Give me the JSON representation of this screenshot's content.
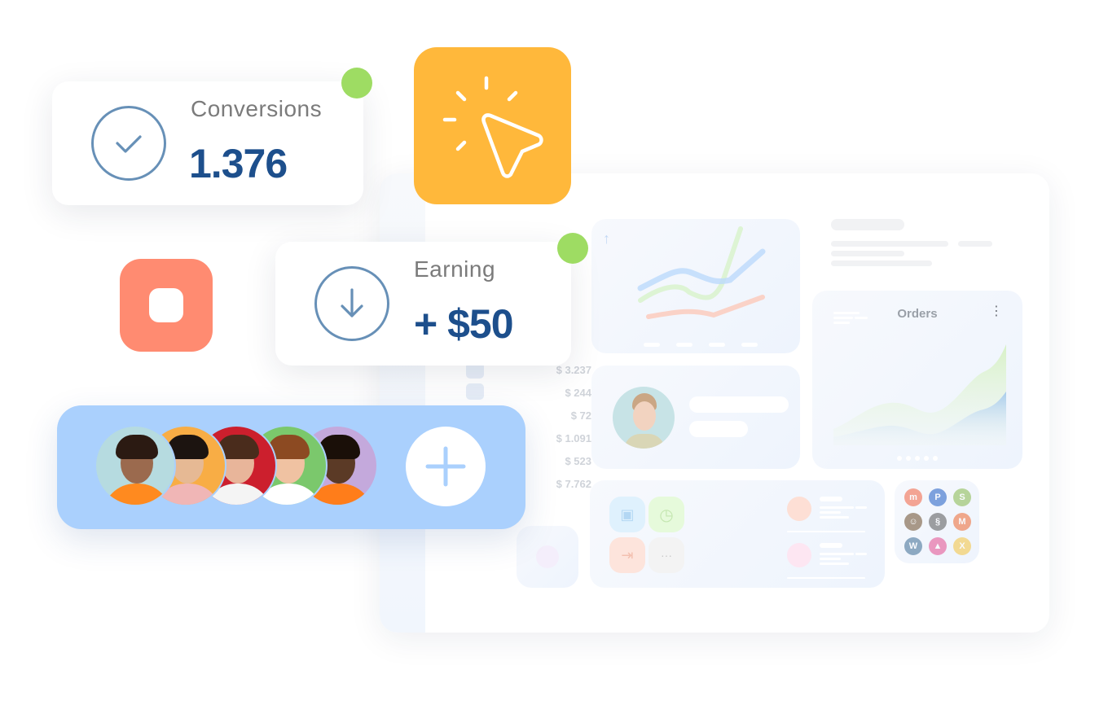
{
  "conversions_card": {
    "label": "Conversions",
    "value": "1.376",
    "icon": "check-circle-icon",
    "status_color": "#9edc63"
  },
  "earning_card": {
    "label": "Earning",
    "value": "+ $50",
    "icon": "arrow-down-circle-icon",
    "status_color": "#9edc63"
  },
  "cursor_tile": {
    "icon": "cursor-click-icon",
    "color": "#ffb83b"
  },
  "stop_tile": {
    "icon": "stop-icon",
    "color": "#ff8b71"
  },
  "team": {
    "avatars": [
      {
        "name": "team-member-1",
        "bg": "#b6dbe0",
        "skin": "#9b6a4e",
        "hair": "#2b1a12",
        "shirt": "#ff8a1f"
      },
      {
        "name": "team-member-2",
        "bg": "#f8ad45",
        "skin": "#e6b994",
        "hair": "#1c1410",
        "shirt": "#f0b6b6"
      },
      {
        "name": "team-member-3",
        "bg": "#cc1f2d",
        "skin": "#e8b59a",
        "hair": "#4a2c1c",
        "shirt": "#f4f4f4"
      },
      {
        "name": "team-member-4",
        "bg": "#7bc86c",
        "skin": "#f0c2a2",
        "hair": "#8c4a22",
        "shirt": "#ffffff"
      },
      {
        "name": "team-member-5",
        "bg": "#c4a9dc",
        "skin": "#5b3a26",
        "hair": "#1a0f08",
        "shirt": "#ff7d1a"
      }
    ],
    "add_icon": "plus-icon"
  },
  "dashboard": {
    "amounts": [
      "$ 3.237",
      "$ 244",
      "$ 72",
      "$ 1.091",
      "$ 523",
      "$ 7.762"
    ],
    "orders_title": "Orders",
    "orders_menu_icon": "more-vertical-icon",
    "line_chart_icon": "arrow-up-icon",
    "app_tiles": [
      {
        "icon": "image-check-icon",
        "color": "#dff1fd"
      },
      {
        "icon": "clock-database-icon",
        "color": "#e6fadb"
      },
      {
        "icon": "wallet-transfer-icon",
        "color": "#fde4dc"
      },
      {
        "icon": "more-horizontal-icon",
        "color": "#f3f3f3"
      }
    ],
    "contacts": [
      {
        "avatar_color": "#fddfd5"
      },
      {
        "avatar_color": "#fde6f2"
      }
    ],
    "integrations": [
      {
        "name": "m-logo-icon",
        "color": "#f2603f",
        "glyph": "m"
      },
      {
        "name": "paypal-icon",
        "color": "#1c5bc4",
        "glyph": "P"
      },
      {
        "name": "shopify-icon",
        "color": "#86b84a",
        "glyph": "S"
      },
      {
        "name": "mailchimp-icon",
        "color": "#6b4c2a",
        "glyph": "☺"
      },
      {
        "name": "squarespace-icon",
        "color": "#555555",
        "glyph": "§"
      },
      {
        "name": "magento-icon",
        "color": "#ee672f",
        "glyph": "M"
      },
      {
        "name": "wordpress-icon",
        "color": "#3b6b93",
        "glyph": "W"
      },
      {
        "name": "flame-logo-icon",
        "color": "#e44b8e",
        "glyph": "▲"
      },
      {
        "name": "wix-icon",
        "color": "#f5c33b",
        "glyph": "X"
      }
    ]
  }
}
